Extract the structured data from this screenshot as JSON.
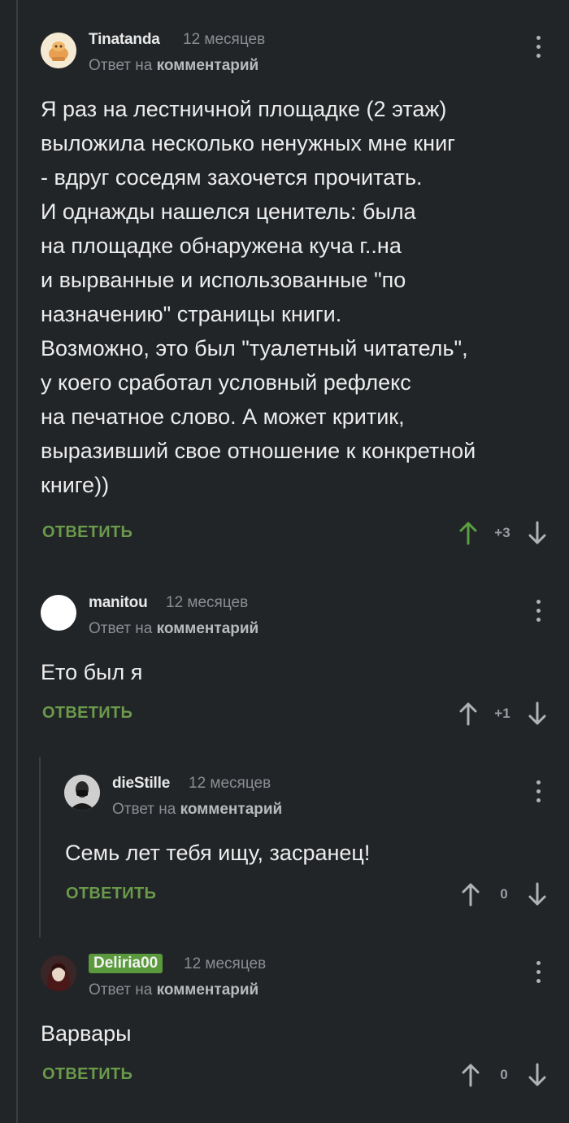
{
  "comments": [
    {
      "author": "Tinatanda",
      "time": "12 месяцев",
      "reply_prefix": "Ответ на",
      "reply_target": "комментарий",
      "text": "Я раз на лестничной площадке (2 этаж)\nвыложила несколько ненужных мне книг\n- вдруг соседям захочется прочитать.\nИ однажды нашелся ценитель: была\nна площадке обнаружена куча г..на\nи вырванные и использованные \"по\nназначению\" страницы книги.\nВозможно, это был \"туалетный читатель\",\nу коего сработал условный рефлекс\nна печатное слово. А может критик,\nвыразивший свое отношение к конкретной\nкниге))",
      "reply_label": "ОТВЕТИТЬ",
      "rating": "+3",
      "upvoted": true
    },
    {
      "author": "manitou",
      "time": "12 месяцев",
      "reply_prefix": "Ответ на",
      "reply_target": "комментарий",
      "text": "Ето был я",
      "reply_label": "ОТВЕТИТЬ",
      "rating": "+1",
      "upvoted": false
    },
    {
      "author": "dieStille",
      "time": "12 месяцев",
      "reply_prefix": "Ответ на",
      "reply_target": "комментарий",
      "text": "Семь лет тебя ищу, засранец!",
      "reply_label": "ОТВЕТИТЬ",
      "rating": "0",
      "upvoted": false
    },
    {
      "author": "Deliria00",
      "time": "12 месяцев",
      "reply_prefix": "Ответ на",
      "reply_target": "комментарий",
      "text": "Варвары",
      "reply_label": "ОТВЕТИТЬ",
      "rating": "0",
      "upvoted": false
    }
  ],
  "colors": {
    "background": "#222528",
    "accent_green": "#6a9a4a",
    "badge_green": "#5a9a3c",
    "muted": "#8a8e92"
  },
  "icons": {
    "menu": "kebab-menu-icon",
    "upvote": "arrow-up-icon",
    "downvote": "arrow-down-icon"
  }
}
